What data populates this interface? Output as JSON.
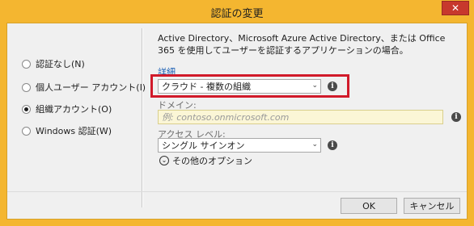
{
  "window": {
    "title": "認証の変更",
    "close_glyph": "✕"
  },
  "auth_options": [
    {
      "label": "認証なし(N)",
      "selected": false
    },
    {
      "label": "個人ユーザー アカウント(I)",
      "selected": false
    },
    {
      "label": "組織アカウント(O)",
      "selected": true
    },
    {
      "label": "Windows 認証(W)",
      "selected": false
    }
  ],
  "description": "Active Directory、Microsoft Azure Active Directory、または Office 365 を使用してユーザーを認証するアプリケーションの場合。",
  "details_link": "詳細",
  "org_type": {
    "selected": "クラウド - 複数の組織"
  },
  "domain": {
    "label": "ドメイン:",
    "placeholder": "例: contoso.onmicrosoft.com",
    "value": ""
  },
  "access_level": {
    "label": "アクセス レベル:",
    "selected": "シングル サインオン"
  },
  "more_options": "その他のオプション",
  "buttons": {
    "ok": "OK",
    "cancel": "キャンセル"
  },
  "icons": {
    "info": "info-icon",
    "chevron": "chevron-down-icon"
  },
  "colors": {
    "title_bar": "#f4b630",
    "close_button": "#c7382d",
    "highlight_border": "#d11a2a",
    "link": "#1a5fb4",
    "domain_input_bg": "#fbf6d6"
  }
}
